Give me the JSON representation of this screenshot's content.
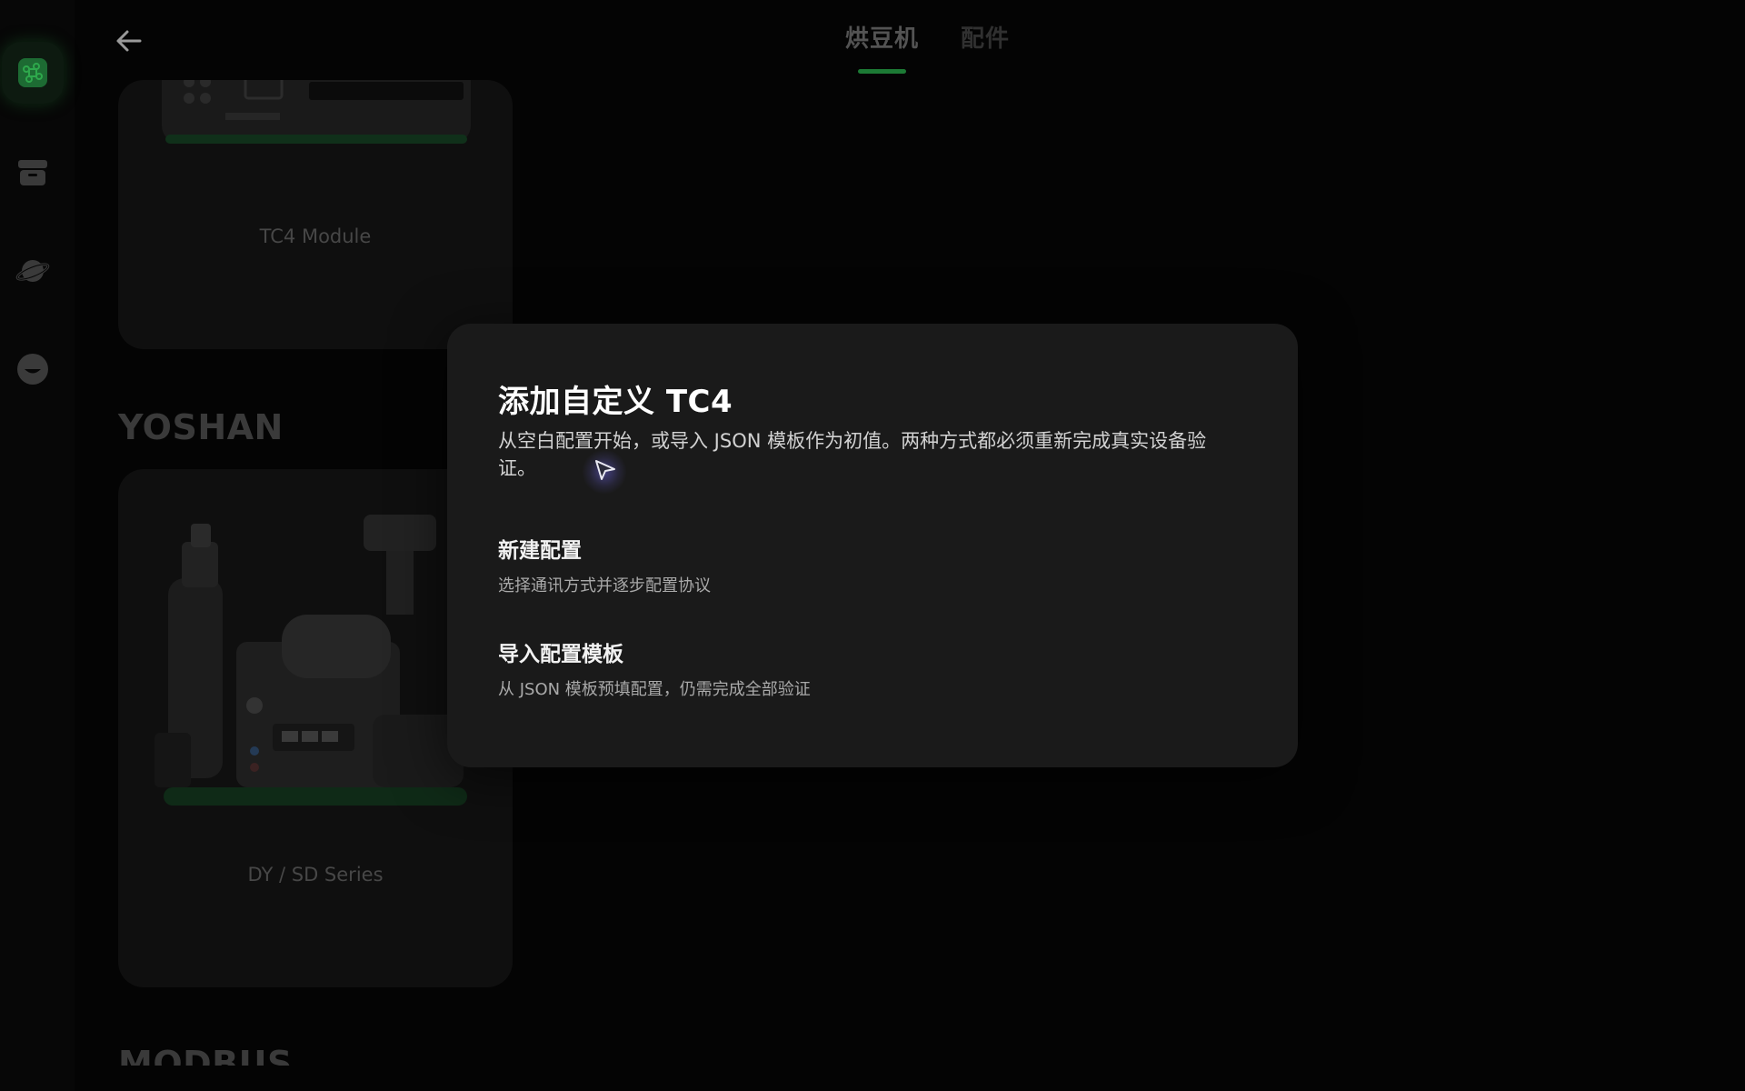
{
  "header": {
    "tabs": [
      {
        "label": "烘豆机",
        "active": true
      },
      {
        "label": "配件",
        "active": false
      }
    ]
  },
  "sidebar": {
    "items": [
      {
        "icon": "command-icon",
        "active": true
      },
      {
        "icon": "archive-icon",
        "active": false
      },
      {
        "icon": "planet-icon",
        "active": false
      },
      {
        "icon": "smile-icon",
        "active": false
      }
    ]
  },
  "background": {
    "cards": [
      {
        "label": "TC4 Module"
      },
      {
        "label": "DY / SD Series"
      }
    ],
    "brands": [
      "YOSHAN",
      "MODBUS"
    ]
  },
  "modal": {
    "title": "添加自定义 TC4",
    "description": "从空白配置开始，或导入 JSON 模板作为初值。两种方式都必须重新完成真实设备验证。",
    "options": [
      {
        "title": "新建配置",
        "subtitle": "选择通讯方式并逐步配置协议"
      },
      {
        "title": "导入配置模板",
        "subtitle": "从 JSON 模板预填配置，仍需完成全部验证"
      }
    ]
  },
  "colors": {
    "accent": "#1c7a35",
    "modal_bg": "#1a1a1a",
    "page_bg": "#040404"
  }
}
